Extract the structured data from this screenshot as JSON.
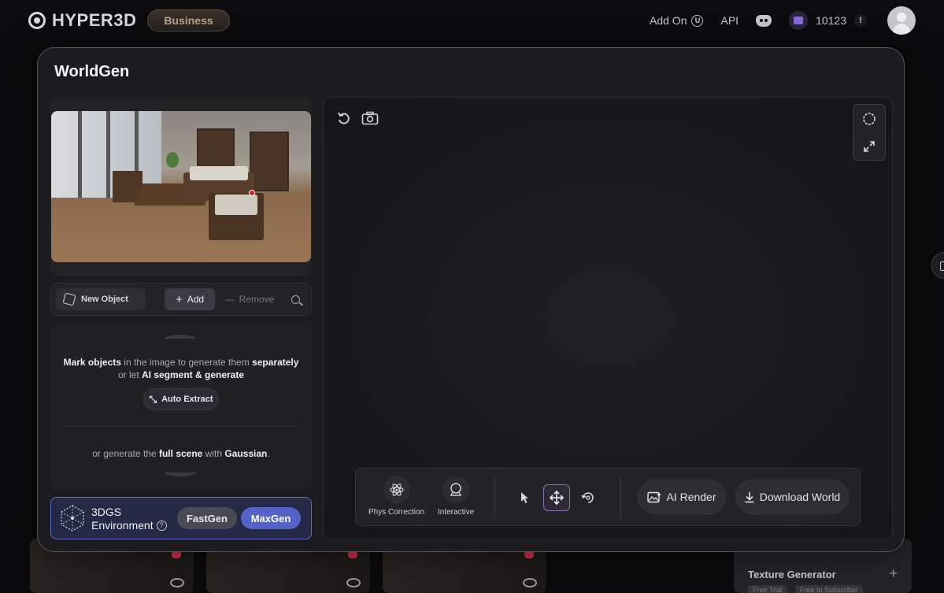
{
  "topbar": {
    "brand": "HYPER3D",
    "plan": "Business",
    "add_on": "Add On",
    "api": "API",
    "credits": "10123",
    "alert_symbol": "!",
    "icons": [
      "logo-icon",
      "unreal-icon",
      "discord-icon",
      "wallet-icon",
      "avatar-icon"
    ]
  },
  "modal": {
    "title": "WorldGen"
  },
  "objects": {
    "new_object": "New Object",
    "add": "Add",
    "remove": "Remove"
  },
  "info": {
    "l1_b1": "Mark objects",
    "l1_t1": " in the image to generate them ",
    "l1_b2": "separately",
    "l2_t1": "or let ",
    "l2_b1": "AI segment & generate",
    "auto_extract": "Auto Extract",
    "l3_t1": "or generate the ",
    "l3_b1": "full scene",
    "l3_t2": " with ",
    "l3_b2": "Gaussian",
    "l3_t3": "."
  },
  "environment": {
    "title": "3DGS",
    "subtitle": "Environment",
    "help": "?",
    "fast": "FastGen",
    "max": "MaxGen",
    "selected": "MaxGen"
  },
  "viewport_toolbar": {
    "phys": "Phys Correction",
    "interactive": "Interactive",
    "ai_render": "AI Render",
    "download": "Download World",
    "active_tool": "move"
  },
  "background": {
    "texture_generator": "Texture Generator",
    "tags": [
      "Free Trial",
      "Free to Subscriber"
    ]
  },
  "colors": {
    "accent": "#5563c9",
    "active_tool_border": "#8d6fb8",
    "favorite": "#d9303c"
  }
}
